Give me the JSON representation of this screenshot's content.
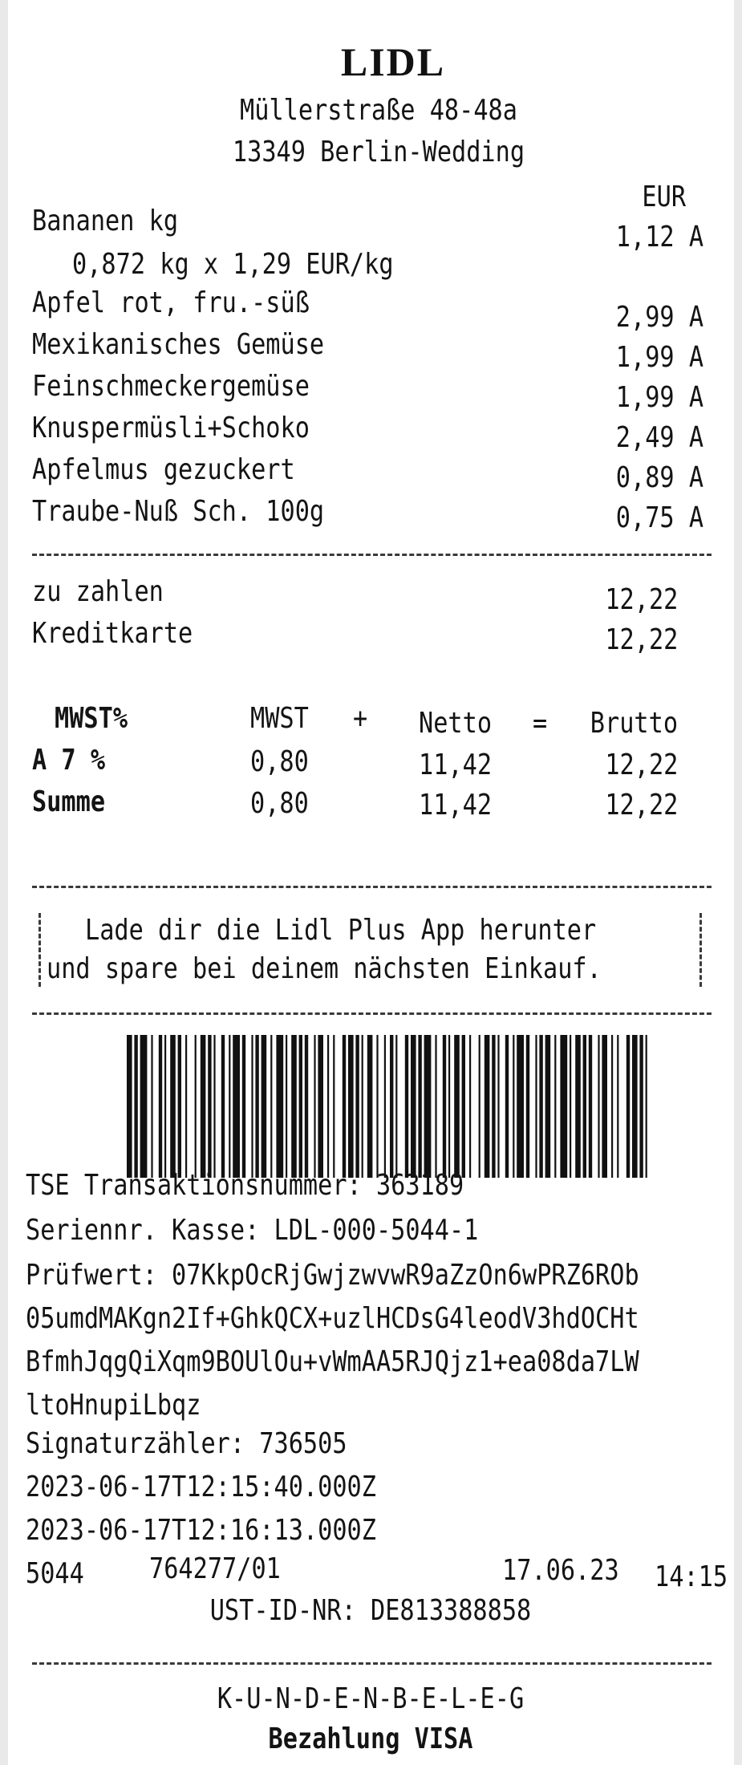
{
  "store": {
    "logo_text": "LIDL",
    "street": "Müllerstraße 48-48a",
    "city": "13349  Berlin-Wedding",
    "currency": "EUR"
  },
  "items": [
    {
      "name": "Bananen kg",
      "detail": "0,872 kg x 1,29  EUR/kg",
      "price": "1,12 A"
    },
    {
      "name": "Apfel rot, fru.-süß",
      "price": "2,99 A"
    },
    {
      "name": "Mexikanisches Gemüse",
      "price": "1,99 A"
    },
    {
      "name": "Feinschmeckergemüse",
      "price": "1,99 A"
    },
    {
      "name": "Knuspermüsli+Schoko",
      "price": "2,49 A"
    },
    {
      "name": "Apfelmus gezuckert",
      "price": "0,89 A"
    },
    {
      "name": "Traube-Nuß Sch. 100g",
      "price": "0,75 A"
    }
  ],
  "totals": {
    "to_pay_label": "zu zahlen",
    "to_pay_value": "12,22",
    "payment_label": "Kreditkarte",
    "payment_value": "12,22"
  },
  "tax": {
    "headers": {
      "rate": "MWST%",
      "tax": "MWST",
      "plus": "+",
      "net": "Netto",
      "eq": "=",
      "gross": "Brutto"
    },
    "rows": [
      {
        "rate": "A  7 %",
        "tax": "0,80",
        "net": "11,42",
        "gross": "12,22"
      },
      {
        "rate": "Summe",
        "tax": "0,80",
        "net": "11,42",
        "gross": "12,22"
      }
    ]
  },
  "promo": {
    "line1": "Lade dir die Lidl Plus App herunter",
    "line2": "und spare bei deinem nächsten Einkauf."
  },
  "tse": {
    "transaction": "TSE Transaktionsnummer: 363189",
    "serial": "Seriennr. Kasse: LDL-000-5044-1",
    "check_label": "Prüfwert: 07KkpOcRjGwjzwvwR9aZzOn6wPRZ6ROb",
    "check_line2": "05umdMAKgn2If+GhkQCX+uzlHCDsG4leodV3hdOCHt",
    "check_line3": "BfmhJqgQiXqm9BOUlOu+vWmAA5RJQjz1+ea08da7LW",
    "check_line4": "ltoHnupiLbqz",
    "counter": "Signaturzähler: 736505",
    "start": "2023-06-17T12:15:40.000Z",
    "end": "2023-06-17T12:16:13.000Z"
  },
  "footer": {
    "store_no": "5044",
    "receipt_no": "764277/01",
    "date": "17.06.23",
    "time": "14:15",
    "vat_id": "UST-ID-NR: DE813388858",
    "receipt_type": "K-U-N-D-E-N-B-E-L-E-G",
    "payment_method": "Bezahlung VISA"
  }
}
